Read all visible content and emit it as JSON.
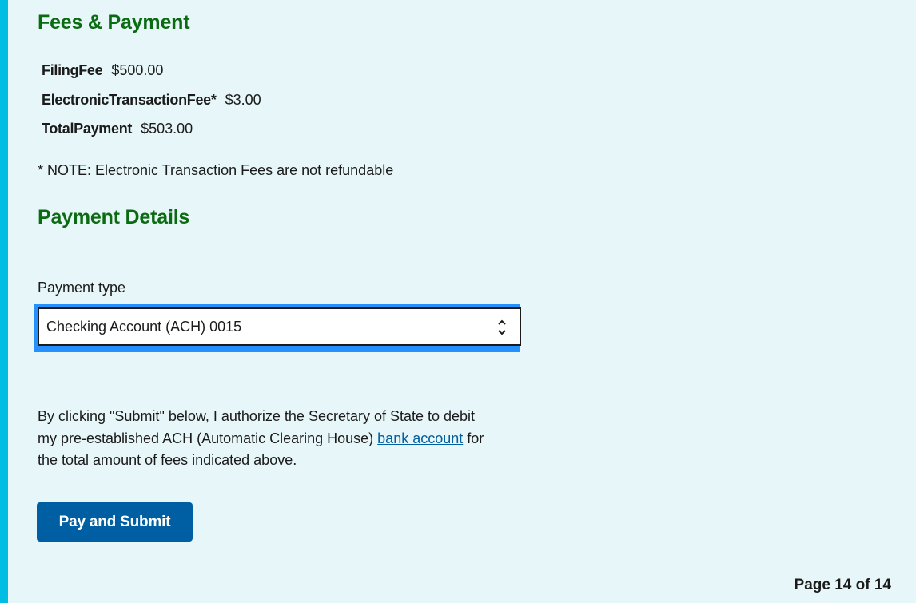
{
  "colors": {
    "accent_bar": "#00bde3",
    "heading": "#0b6b12",
    "background": "#e7f6f8",
    "primary_button": "#005ea2",
    "focus_ring": "#2491ff",
    "link": "#005ea2"
  },
  "fees_section": {
    "title": "Fees & Payment",
    "rows": [
      {
        "label": "FilingFee",
        "value": "$500.00"
      },
      {
        "label": "ElectronicTransactionFee*",
        "value": "$3.00"
      },
      {
        "label": "TotalPayment",
        "value": "$503.00"
      }
    ],
    "note": "* NOTE: Electronic Transaction Fees are not refundable"
  },
  "payment_section": {
    "title": "Payment Details",
    "payment_type_label": "Payment type",
    "payment_type_value": "Checking Account (ACH) 0015",
    "payment_type_icon": "up-down-chevron-icon",
    "authorization": {
      "text_before_link": "By clicking \"Submit\" below, I authorize the Secretary of State to debit my pre-established ACH (Automatic Clearing House) ",
      "link_text": "bank account",
      "text_after_link": " for the total amount of fees indicated above."
    },
    "submit_label": "Pay and Submit"
  },
  "pagination": {
    "label": "Page 14 of 14"
  }
}
